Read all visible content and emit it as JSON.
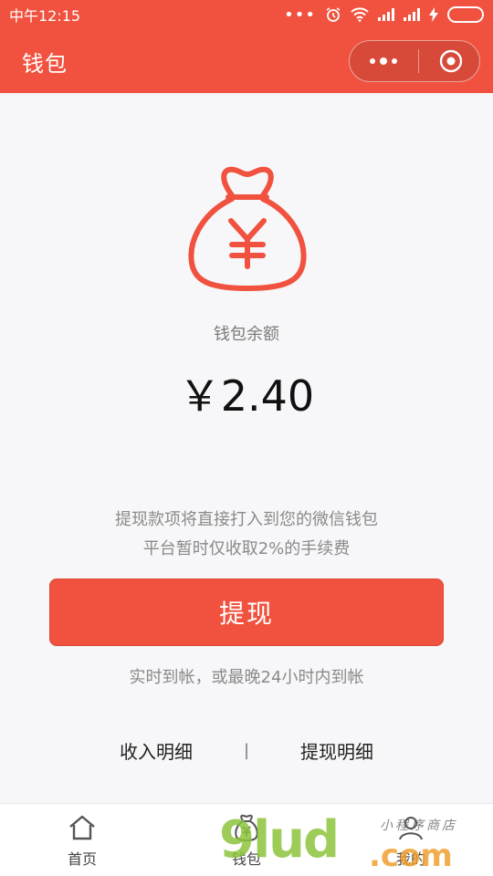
{
  "status_bar": {
    "time": "中午12:15",
    "dots": "•••"
  },
  "header": {
    "title": "钱包"
  },
  "wallet": {
    "balance_label": "钱包余额",
    "balance_amount": "￥2.40",
    "notice_line1": "提现款项将直接打入到您的微信钱包",
    "notice_line2": "平台暂时仅收取2%的手续费",
    "withdraw_label": "提现",
    "arrival_text": "实时到帐，或最晚24小时内到帐",
    "income_detail_label": "收入明细",
    "separator": "|",
    "withdraw_detail_label": "提现明细"
  },
  "tabbar": {
    "tabs": [
      {
        "label": "首页",
        "icon": "home-icon"
      },
      {
        "label": "钱包",
        "icon": "wallet-icon"
      },
      {
        "label": "我的",
        "icon": "user-icon"
      }
    ]
  },
  "watermark": {
    "main": "9lud",
    "suffix": ".com",
    "small": "小程序商店"
  },
  "colors": {
    "accent": "#f0523f",
    "watermark_green": "#8cc43c",
    "watermark_orange": "#f0a030"
  }
}
